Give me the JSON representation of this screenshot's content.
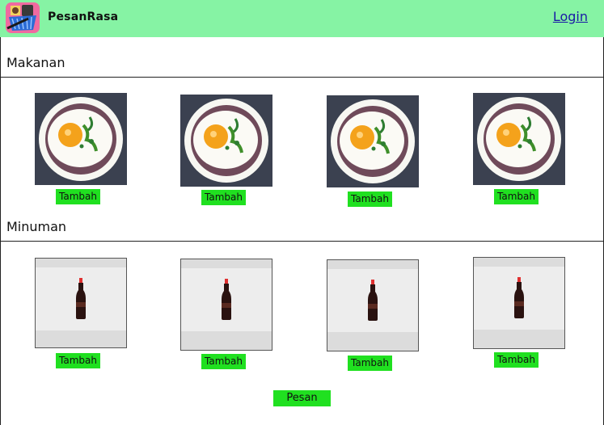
{
  "header": {
    "brand": "PesanRasa",
    "login_label": "Login",
    "logo_icon": "shopping-basket-icon",
    "background": "#86f3a4"
  },
  "sections": [
    {
      "title": "Makanan",
      "items": [
        {
          "image": "fried-egg-rice-bowl",
          "button_label": "Tambah"
        },
        {
          "image": "fried-egg-rice-bowl",
          "button_label": "Tambah"
        },
        {
          "image": "fried-egg-rice-bowl",
          "button_label": "Tambah"
        },
        {
          "image": "fried-egg-rice-bowl",
          "button_label": "Tambah"
        }
      ]
    },
    {
      "title": "Minuman",
      "items": [
        {
          "image": "cola-bottle",
          "button_label": "Tambah"
        },
        {
          "image": "cola-bottle",
          "button_label": "Tambah"
        },
        {
          "image": "cola-bottle",
          "button_label": "Tambah"
        },
        {
          "image": "cola-bottle",
          "button_label": "Tambah"
        }
      ]
    }
  ],
  "footer": {
    "order_label": "Pesan"
  },
  "colors": {
    "accent_green": "#20e020",
    "link": "#1a1aa6"
  }
}
